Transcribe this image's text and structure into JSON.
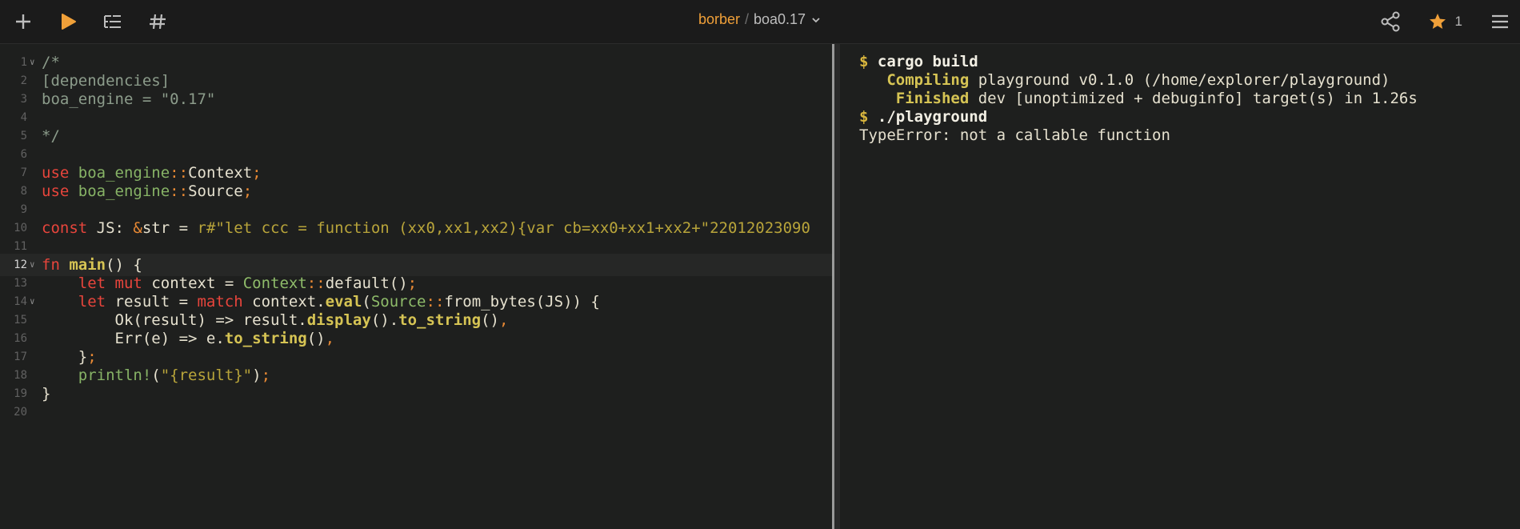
{
  "header": {
    "owner": "borber",
    "separator": "/",
    "project": "boa0.17",
    "star_count": "1",
    "icons": [
      "plus-icon",
      "play-icon",
      "outline-icon",
      "hash-icon",
      "share-icon",
      "star-icon",
      "menu-icon"
    ],
    "accent": "#f0a039"
  },
  "editor": {
    "lines": [
      {
        "num": "1",
        "fold": true,
        "tokens": [
          [
            "c-com",
            "/*"
          ]
        ]
      },
      {
        "num": "2",
        "tokens": [
          [
            "c-com",
            "[dependencies]"
          ]
        ]
      },
      {
        "num": "3",
        "tokens": [
          [
            "c-com",
            "boa_engine = \"0.17\""
          ]
        ]
      },
      {
        "num": "4",
        "tokens": []
      },
      {
        "num": "5",
        "tokens": [
          [
            "c-com",
            "*/"
          ]
        ]
      },
      {
        "num": "6",
        "tokens": []
      },
      {
        "num": "7",
        "tokens": [
          [
            "c-kw",
            "use"
          ],
          [
            "c-plain",
            " "
          ],
          [
            "c-mod",
            "boa_engine"
          ],
          [
            "c-pun",
            "::"
          ],
          [
            "c-plain",
            "Context"
          ],
          [
            "c-pun",
            ";"
          ]
        ]
      },
      {
        "num": "8",
        "tokens": [
          [
            "c-kw",
            "use"
          ],
          [
            "c-plain",
            " "
          ],
          [
            "c-mod",
            "boa_engine"
          ],
          [
            "c-pun",
            "::"
          ],
          [
            "c-plain",
            "Source"
          ],
          [
            "c-pun",
            ";"
          ]
        ]
      },
      {
        "num": "9",
        "tokens": []
      },
      {
        "num": "10",
        "tokens": [
          [
            "c-kw",
            "const"
          ],
          [
            "c-plain",
            " JS: "
          ],
          [
            "c-pun",
            "&"
          ],
          [
            "c-plain",
            "str = "
          ],
          [
            "c-str",
            "r#\"let ccc = function (xx0,xx1,xx2){var cb=xx0+xx1+xx2+\"22012023090"
          ]
        ]
      },
      {
        "num": "11",
        "tokens": []
      },
      {
        "num": "12",
        "fold": true,
        "active": true,
        "tokens": [
          [
            "c-kw",
            "fn"
          ],
          [
            "c-plain",
            " "
          ],
          [
            "c-fn",
            "main"
          ],
          [
            "c-plain",
            "() {"
          ]
        ]
      },
      {
        "num": "13",
        "tokens": [
          [
            "c-plain",
            "    "
          ],
          [
            "c-kw",
            "let"
          ],
          [
            "c-plain",
            " "
          ],
          [
            "c-kw",
            "mut"
          ],
          [
            "c-plain",
            " context = "
          ],
          [
            "c-ty",
            "Context"
          ],
          [
            "c-pun",
            "::"
          ],
          [
            "c-plain",
            "default()"
          ],
          [
            "c-pun",
            ";"
          ]
        ]
      },
      {
        "num": "14",
        "fold": true,
        "tokens": [
          [
            "c-plain",
            "    "
          ],
          [
            "c-kw",
            "let"
          ],
          [
            "c-plain",
            " result = "
          ],
          [
            "c-kw",
            "match"
          ],
          [
            "c-plain",
            " context."
          ],
          [
            "c-fn",
            "eval"
          ],
          [
            "c-plain",
            "("
          ],
          [
            "c-ty",
            "Source"
          ],
          [
            "c-pun",
            "::"
          ],
          [
            "c-plain",
            "from_bytes(JS)) {"
          ]
        ]
      },
      {
        "num": "15",
        "tokens": [
          [
            "c-plain",
            "        Ok(result) => result."
          ],
          [
            "c-fn",
            "display"
          ],
          [
            "c-plain",
            "()."
          ],
          [
            "c-fn",
            "to_string"
          ],
          [
            "c-plain",
            "()"
          ],
          [
            "c-pun",
            ","
          ]
        ]
      },
      {
        "num": "16",
        "tokens": [
          [
            "c-plain",
            "        Err(e) => e."
          ],
          [
            "c-fn",
            "to_string"
          ],
          [
            "c-plain",
            "()"
          ],
          [
            "c-pun",
            ","
          ]
        ]
      },
      {
        "num": "17",
        "tokens": [
          [
            "c-plain",
            "    }"
          ],
          [
            "c-pun",
            ";"
          ]
        ]
      },
      {
        "num": "18",
        "tokens": [
          [
            "c-plain",
            "    "
          ],
          [
            "c-mac",
            "println!"
          ],
          [
            "c-plain",
            "("
          ],
          [
            "c-str",
            "\"{result}\""
          ],
          [
            "c-plain",
            ")"
          ],
          [
            "c-pun",
            ";"
          ]
        ]
      },
      {
        "num": "19",
        "tokens": [
          [
            "c-plain",
            "}"
          ]
        ]
      },
      {
        "num": "20",
        "tokens": []
      }
    ]
  },
  "output": {
    "lines": [
      {
        "parts": [
          [
            "prompt",
            "$ "
          ],
          [
            "cmd",
            "cargo build"
          ]
        ]
      },
      {
        "parts": [
          [
            "status",
            "   Compiling"
          ],
          [
            "otext",
            " playground v0.1.0 (/home/explorer/playground)"
          ]
        ]
      },
      {
        "parts": [
          [
            "status",
            "    Finished"
          ],
          [
            "otext",
            " dev [unoptimized + debuginfo] target(s) in 1.26s"
          ]
        ]
      },
      {
        "parts": [
          [
            "prompt",
            "$ "
          ],
          [
            "cmd",
            "./playground"
          ]
        ]
      },
      {
        "parts": [
          [
            "otext",
            "TypeError: not a callable function"
          ]
        ]
      }
    ]
  }
}
